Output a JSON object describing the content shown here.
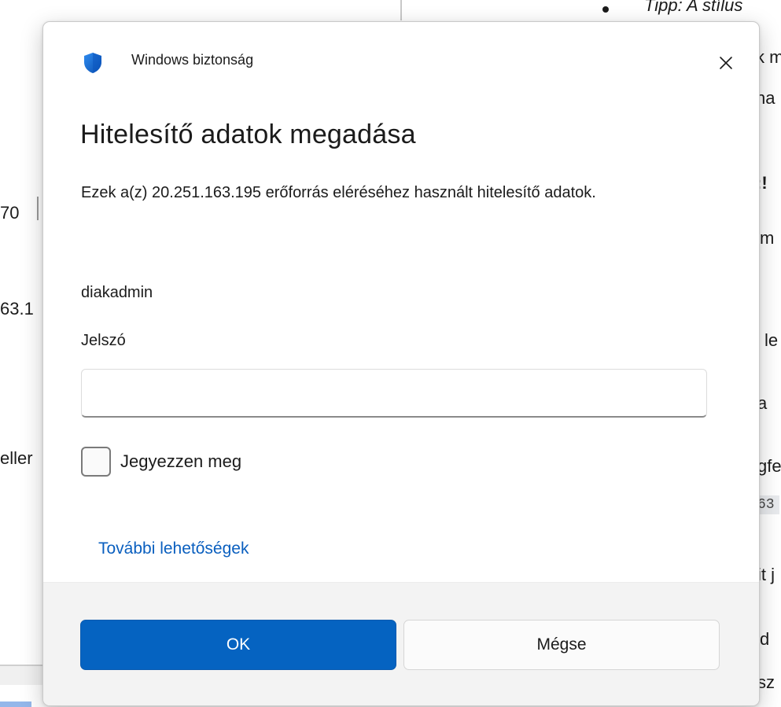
{
  "dialog": {
    "app_title": "Windows biztonság",
    "heading": "Hitelesítő adatok megadása",
    "description": "Ezek a(z) 20.251.163.195 erőforrás eléréséhez használt hitelesítő adatok.",
    "username": "diakadmin",
    "password_label": "Jelszó",
    "password_value": "",
    "remember_label": "Jegyezzen meg",
    "remember_checked": false,
    "more_options_label": "További lehetőségek",
    "ok_label": "OK",
    "cancel_label": "Mégse",
    "accent_color": "#0563c1",
    "shield_color": "#0a63c9"
  },
  "background": {
    "right_fragments": [
      "Tipp: A stílus",
      "k m",
      "na",
      ":!",
      "m",
      "l le",
      "a",
      "gfe",
      "63",
      "it j",
      "d",
      "sz"
    ],
    "left_fragments": [
      "70",
      "63.1",
      "eller"
    ]
  }
}
